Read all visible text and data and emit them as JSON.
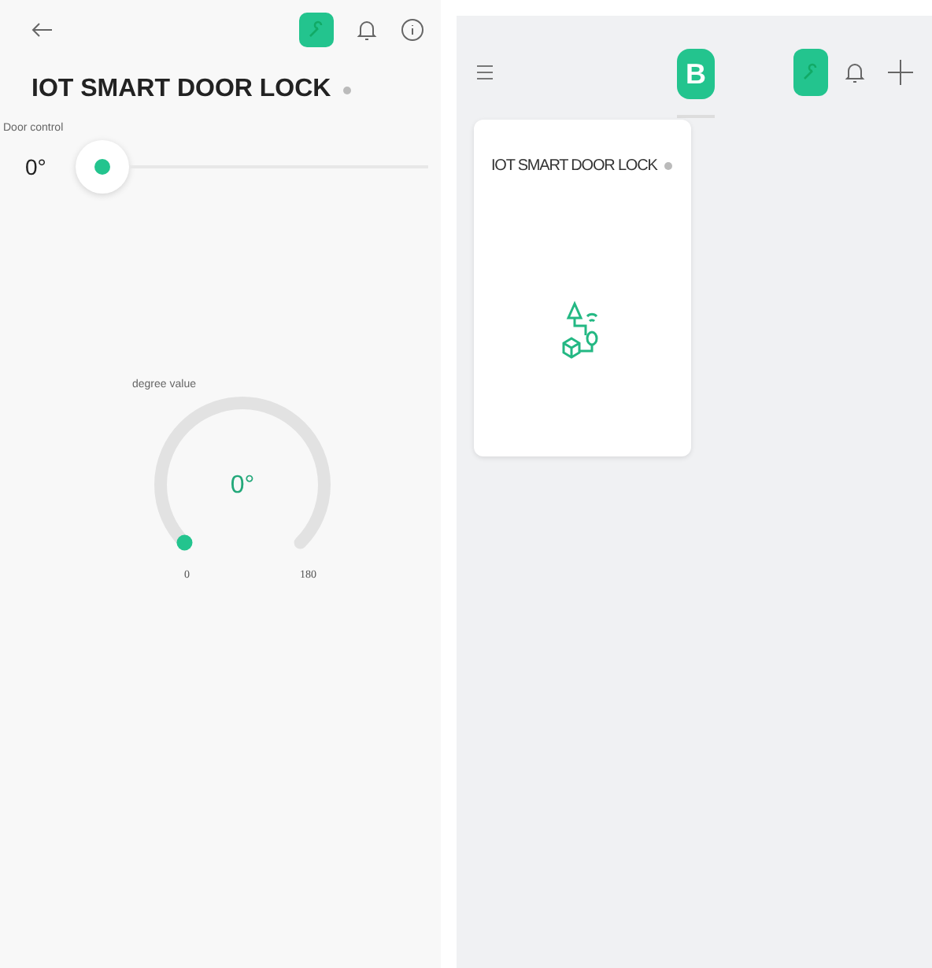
{
  "detail": {
    "title": "IOT SMART DOOR LOCK",
    "online": false,
    "slider": {
      "label": "Door control",
      "reading": "0°"
    },
    "gauge": {
      "label": "degree value",
      "reading": "0°",
      "min": "0",
      "max": "180"
    }
  },
  "dashboard": {
    "logo": "B",
    "card": {
      "title": "IOT SMART DOOR LOCK",
      "online": false
    }
  }
}
